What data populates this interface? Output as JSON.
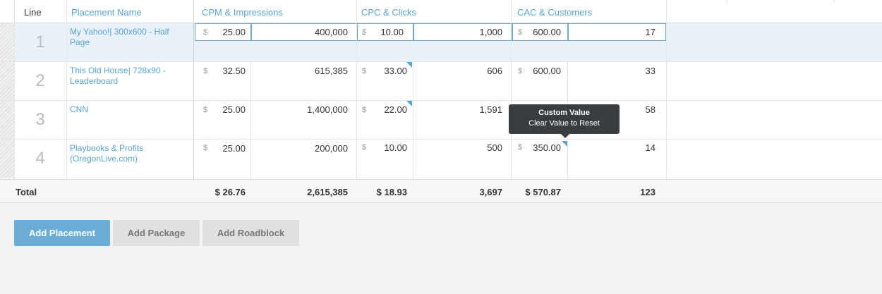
{
  "headers": {
    "line": "Line",
    "placement_name": "Placement Name",
    "cpm_impressions": "CPM & Impressions",
    "cpc_clicks": "CPC & Clicks",
    "cac_customers": "CAC & Customers"
  },
  "currency_symbol": "$",
  "rows": [
    {
      "line": "1",
      "name": "My Yahoo!| 300x600 - Half Page",
      "cpm": "25.00",
      "impressions": "400,000",
      "cpc": "10.00",
      "clicks": "1,000",
      "cac": "600.00",
      "customers": "17"
    },
    {
      "line": "2",
      "name": "This Old House| 728x90 - Leaderboard",
      "cpm": "32.50",
      "impressions": "615,385",
      "cpc": "33.00",
      "clicks": "606",
      "cac": "600.00",
      "customers": "33"
    },
    {
      "line": "3",
      "name": "CNN",
      "cpm": "25.00",
      "impressions": "1,400,000",
      "cpc": "22.00",
      "clicks": "1,591",
      "cac": "",
      "customers": "58"
    },
    {
      "line": "4",
      "name": "Playbooks & Profits (OregonLive.com)",
      "cpm": "25.00",
      "impressions": "200,000",
      "cpc": "10.00",
      "clicks": "500",
      "cac": "350.00",
      "customers": "14"
    }
  ],
  "totals": {
    "label": "Total",
    "cpm": "$ 26.76",
    "impressions": "2,615,385",
    "cpc": "$ 18.93",
    "clicks": "3,697",
    "cac": "$ 570.87",
    "customers": "123"
  },
  "tooltip": {
    "title": "Custom Value",
    "subtitle": "Clear Value to Reset"
  },
  "buttons": {
    "add_placement": "Add Placement",
    "add_package": "Add Package",
    "add_roadblock": "Add Roadblock"
  },
  "colors": {
    "accent": "#5aa4cf",
    "primary_button": "#6aaed8",
    "tooltip_bg": "#3a3d40",
    "selected_row": "#e8f1f8"
  }
}
